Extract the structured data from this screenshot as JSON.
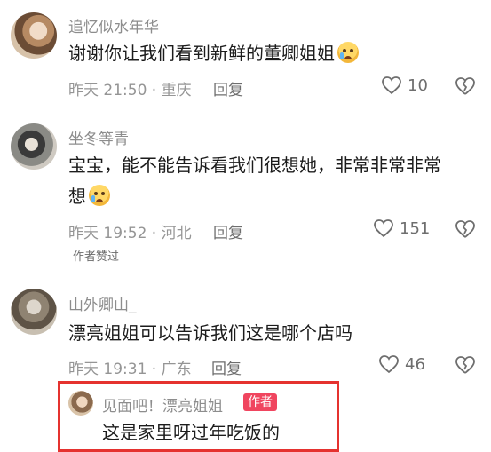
{
  "comments": [
    {
      "username": "追忆似水年华",
      "text_line1": "谢谢你让我们看到新鲜的董卿姐姐",
      "text_line2": "",
      "emoji": "crying-face-icon",
      "meta": "昨天 21:50 · 重庆",
      "reply_label": "回复",
      "likes": "10",
      "author_liked": ""
    },
    {
      "username": "坐冬等青",
      "text_line1": "宝宝，能不能告诉看我们很想她，非常非常非常",
      "text_line2": "想",
      "emoji": "pleading-face-icon",
      "meta": "昨天 19:52 · 河北",
      "reply_label": "回复",
      "likes": "151",
      "author_liked": "作者赞过"
    },
    {
      "username": "山外卿山_",
      "text_line1": "漂亮姐姐可以告诉我们这是哪个店吗",
      "text_line2": "",
      "emoji": "",
      "meta": "昨天 19:31 · 广东",
      "reply_label": "回复",
      "likes": "46",
      "author_liked": ""
    }
  ],
  "sub_reply": {
    "username": "见面吧！漂亮姐姐",
    "author_tag": "作者",
    "text": "这是家里呀过年吃饭的"
  },
  "colors": {
    "highlight_border": "#e5322f",
    "author_tag_bg": "#f0455f"
  }
}
